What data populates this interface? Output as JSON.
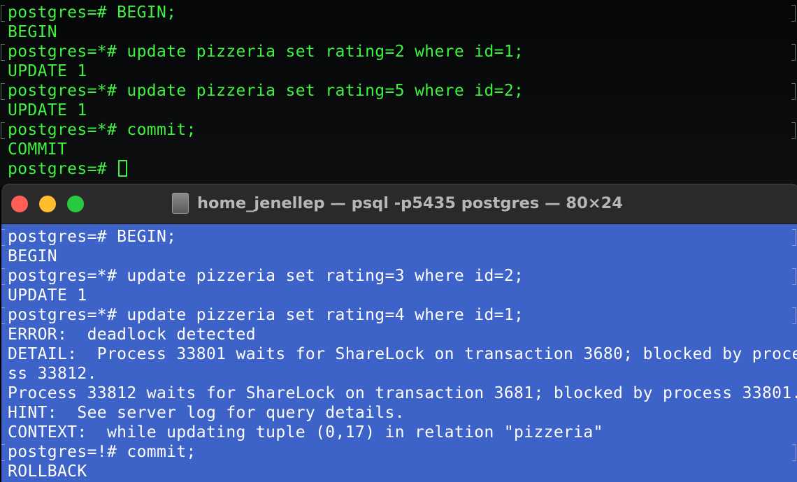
{
  "back_terminal": {
    "lines": [
      {
        "text": "postgres=# BEGIN;",
        "prompt": true
      },
      {
        "text": "BEGIN",
        "prompt": false
      },
      {
        "text": "postgres=*# update pizzeria set rating=2 where id=1;",
        "prompt": true
      },
      {
        "text": "UPDATE 1",
        "prompt": false
      },
      {
        "text": "postgres=*# update pizzeria set rating=5 where id=2;",
        "prompt": true
      },
      {
        "text": "UPDATE 1",
        "prompt": false
      },
      {
        "text": "postgres=*# commit;",
        "prompt": true
      },
      {
        "text": "COMMIT",
        "prompt": false
      },
      {
        "text": "postgres=# ",
        "prompt": false,
        "cursor": true
      }
    ],
    "text_color": "#3ef23e",
    "background_color": "#0a0b0c"
  },
  "front_window": {
    "title": "home_jenellep — psql -p5435 postgres — 80×24",
    "traffic_lights": {
      "close": "#ff5f57",
      "minimize": "#febc2e",
      "zoom": "#28c840"
    },
    "title_icon": "terminal-doc-icon",
    "background_color": "#3d62c8",
    "text_color": "#ffffff",
    "lines": [
      {
        "text": "postgres=# BEGIN;",
        "prompt": true
      },
      {
        "text": "BEGIN",
        "prompt": false
      },
      {
        "text": "postgres=*# update pizzeria set rating=3 where id=2;",
        "prompt": true
      },
      {
        "text": "UPDATE 1",
        "prompt": false
      },
      {
        "text": "postgres=*# update pizzeria set rating=4 where id=1;",
        "prompt": true
      },
      {
        "text": "ERROR:  deadlock detected",
        "prompt": false
      },
      {
        "text": "DETAIL:  Process 33801 waits for ShareLock on transaction 3680; blocked by proce",
        "prompt": false
      },
      {
        "text": "ss 33812.",
        "prompt": false
      },
      {
        "text": "Process 33812 waits for ShareLock on transaction 3681; blocked by process 33801.",
        "prompt": false
      },
      {
        "text": "HINT:  See server log for query details.",
        "prompt": false
      },
      {
        "text": "CONTEXT:  while updating tuple (0,17) in relation \"pizzeria\"",
        "prompt": false
      },
      {
        "text": "postgres=!# commit;",
        "prompt": true
      },
      {
        "text": "ROLLBACK",
        "prompt": false
      }
    ]
  }
}
